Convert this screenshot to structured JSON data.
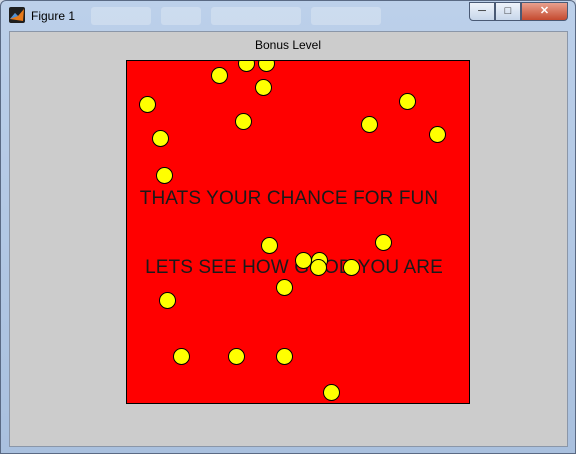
{
  "window": {
    "title": "Figure 1"
  },
  "controls": {
    "minimize": "─",
    "maximize": "□",
    "close": "✕"
  },
  "axes": {
    "title": "Bonus Level",
    "background": "#ff0000",
    "ball_color": "#ffff00",
    "message_line1": "THATS YOUR CHANCE FOR FUN",
    "message_line2": "LETS SEE HOW GOOD YOU ARE"
  },
  "icons": {
    "app": "matlab-icon"
  }
}
